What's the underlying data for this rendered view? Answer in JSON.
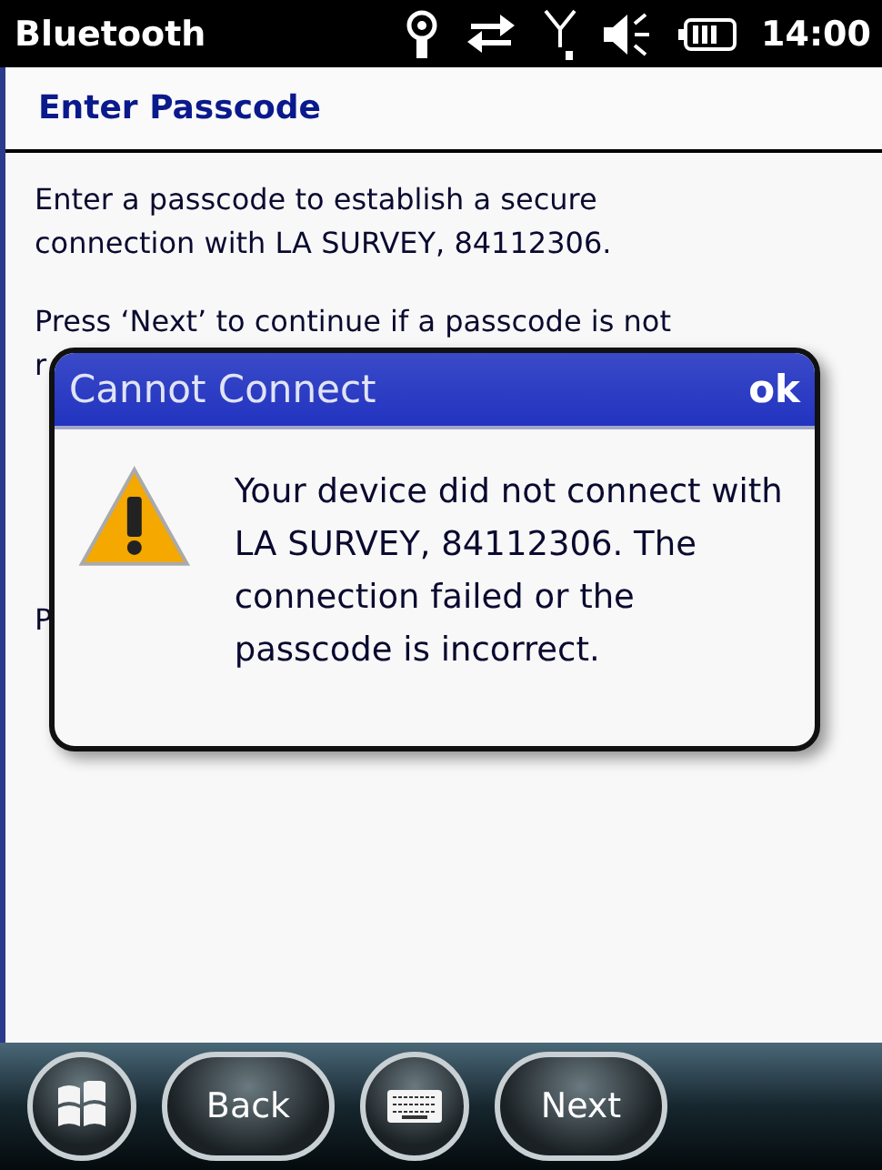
{
  "status_bar": {
    "title": "Bluetooth",
    "time": "14:00"
  },
  "header": {
    "title": "Enter Passcode"
  },
  "body": {
    "paragraphs": [
      "Enter a passcode to establish a secure connection with LA SURVEY, 84112306.",
      "Press ‘Next’ to continue if a passcode is not"
    ],
    "fragments": [
      "r",
      "P"
    ]
  },
  "dialog": {
    "title": "Cannot Connect",
    "ok": "ok",
    "message": "Your device did not connect with LA SURVEY, 84112306. The connection failed or the passcode is incorrect."
  },
  "softkeys": {
    "back": "Back",
    "next": "Next"
  }
}
